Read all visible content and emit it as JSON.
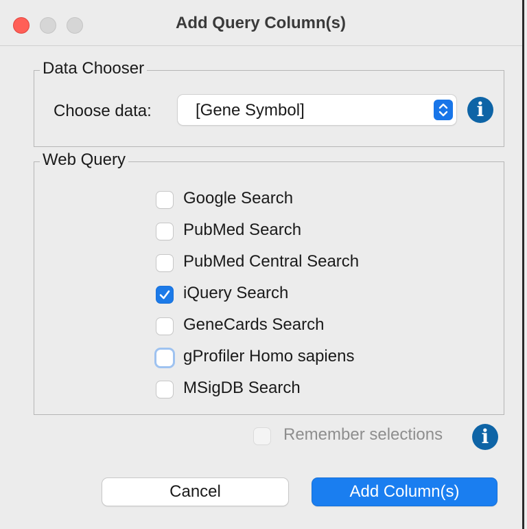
{
  "window": {
    "title": "Add Query Column(s)"
  },
  "data_chooser": {
    "group_title": "Data Chooser",
    "label": "Choose data:",
    "selected": "[Gene Symbol]"
  },
  "web_query": {
    "group_title": "Web Query",
    "options": [
      {
        "label": "Google Search",
        "checked": false
      },
      {
        "label": "PubMed Search",
        "checked": false
      },
      {
        "label": "PubMed Central Search",
        "checked": false
      },
      {
        "label": "iQuery Search",
        "checked": true
      },
      {
        "label": "GeneCards Search",
        "checked": false
      },
      {
        "label": "gProfiler Homo sapiens",
        "checked": false,
        "focused": true
      },
      {
        "label": "MSigDB Search",
        "checked": false
      }
    ]
  },
  "remember": {
    "label": "Remember selections",
    "checked": false,
    "enabled": false
  },
  "buttons": {
    "cancel": "Cancel",
    "add": "Add Column(s)"
  },
  "icons": {
    "info": "i"
  },
  "colors": {
    "accent": "#1a7ef0",
    "info": "#0e64a6",
    "close_light": "#ff5f57"
  }
}
